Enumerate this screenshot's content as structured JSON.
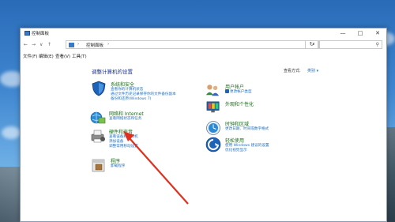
{
  "window": {
    "title": "控制面板",
    "minimize": "—",
    "maximize": "□",
    "close": "✕"
  },
  "nav": {
    "back": "←",
    "forward": "→",
    "down": "∨",
    "up": "↑",
    "address_sep": "›",
    "address_item": "控制面板",
    "address_sep2": "›",
    "dropdown": "∨",
    "refresh": "↻",
    "search_icon": "⚲"
  },
  "menu": {
    "file": "文件(F)",
    "edit": "编辑(E)",
    "view": "查看(V)",
    "tools": "工具(T)"
  },
  "main": {
    "heading": "调整计算机的设置",
    "view_by_label": "查看方式:",
    "view_by_value": "类别 ▾"
  },
  "categories": [
    {
      "title": "系统和安全",
      "icon": "shield-icon",
      "links": [
        "查看你的计算机状态",
        "通过文件历史记录保存你的文件备份副本",
        "备份和还原(Windows 7)"
      ]
    },
    {
      "title": "网络和 Internet",
      "icon": "network-icon",
      "links": [
        "查看网络状态和任务"
      ]
    },
    {
      "title": "硬件和声音",
      "icon": "printer-icon",
      "links": [
        "查看设备和打印机",
        "添加设备",
        "调整常用移动设置"
      ]
    },
    {
      "title": "程序",
      "icon": "programs-icon",
      "links": [
        "卸载程序"
      ]
    },
    {
      "title": "用户帐户",
      "icon": "users-icon",
      "links": [
        "更改帐户类型"
      ]
    },
    {
      "title": "外观和个性化",
      "icon": "appearance-icon",
      "links": []
    },
    {
      "title": "时钟和区域",
      "icon": "clock-icon",
      "links": [
        "更改日期、时间或数字格式"
      ]
    },
    {
      "title": "轻松使用",
      "icon": "accessibility-icon",
      "links": [
        "使用 Windows 建议的设置",
        "优化视觉显示"
      ]
    }
  ],
  "colors": {
    "heading": "#1e3287",
    "category_title": "#1a6e1a",
    "link": "#1f6fc0",
    "arrow": "#e0301e"
  }
}
